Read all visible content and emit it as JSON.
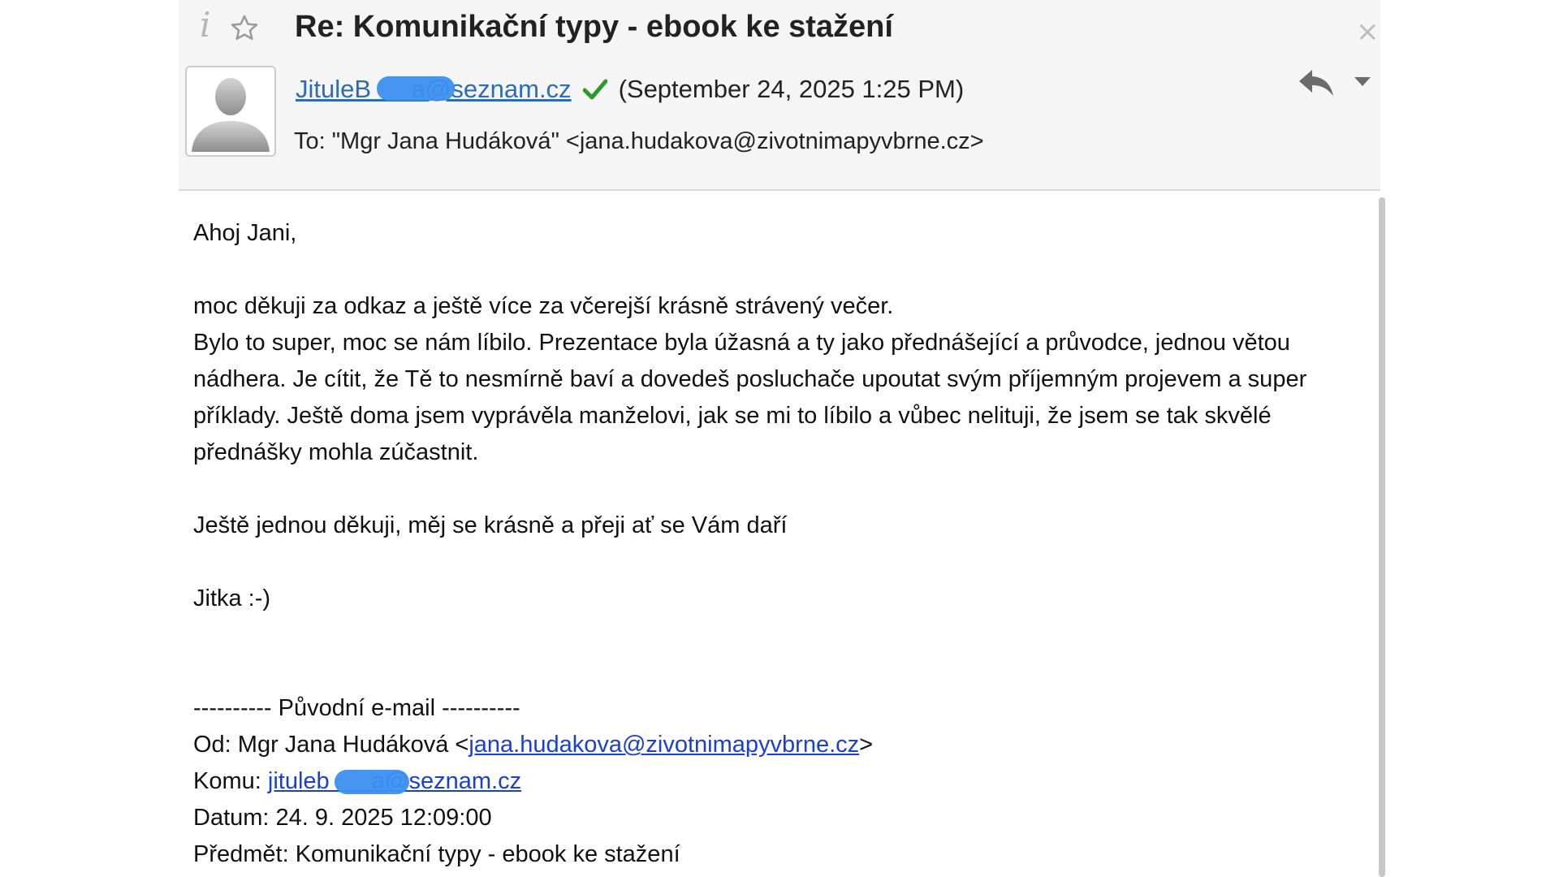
{
  "header": {
    "subject": "Re: Komunikační typy - ebook ke stažení",
    "info_icon": "i",
    "close_icon": "×",
    "sender_email": "JituleB        a@seznam.cz",
    "date": "(September 24, 2025 1:25 PM)",
    "to": "To: \"Mgr Jana Hudáková\" <jana.hudakova@zivotnimapyvbrne.cz>"
  },
  "icons": {
    "info": "info-icon",
    "star": "star-icon",
    "close": "close-icon",
    "verified": "check-icon",
    "reply": "reply-icon",
    "more": "chevron-down-icon",
    "avatar": "avatar-placeholder"
  },
  "colors": {
    "link": "#2d6bb3",
    "body_link": "#1a3fd6",
    "verified": "#2b9a2b",
    "redaction": "#3b8ff0"
  },
  "body": {
    "greeting": "Ahoj Jani,",
    "p1_line1": "moc děkuji za odkaz a ještě více za včerejší krásně strávený večer.",
    "p1_rest": "Bylo to super, moc se nám líbilo. Prezentace byla úžasná a ty jako přednášející a průvodce, jednou větou nádhera. Je cítit, že Tě to nesmírně baví a dovedeš posluchače upoutat svým příjemným projevem a super příklady. Ještě doma jsem vyprávěla manželovi, jak se mi to líbilo a vůbec nelituji, že jsem se tak skvělé přednášky mohla zúčastnit.",
    "thanks": "Ještě jednou děkuji, měj se krásně a přeji ať se Vám daří",
    "signature": "Jitka :-)",
    "original_header": "---------- Původní e-mail ----------",
    "od_label": "Od: Mgr Jana Hudáková <",
    "od_email": "jana.hudakova@zivotnimapyvbrne.cz",
    "od_close": ">",
    "komu_label": "Komu: ",
    "komu_email": "jituleb         a@seznam.cz",
    "datum": "Datum: 24. 9. 2025 12:09:00",
    "predmet": "Předmět: Komunikační typy - ebook ke stažení"
  }
}
